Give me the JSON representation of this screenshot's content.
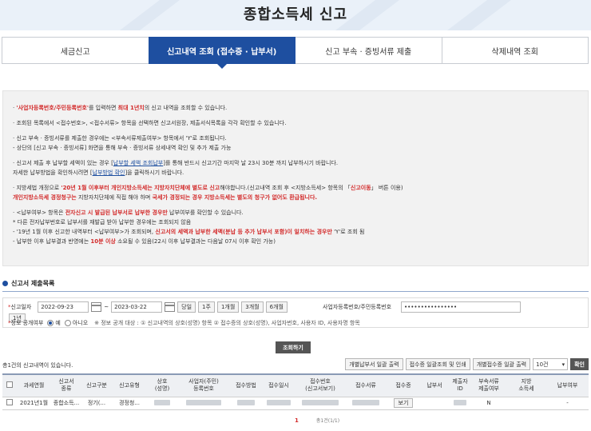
{
  "page_title": "종합소득세 신고",
  "tabs": [
    {
      "label": "세금신고",
      "active": false
    },
    {
      "label": "신고내역 조회 (접수증 · 납부서)",
      "active": true
    },
    {
      "label": "신고 부속 · 증빙서류 제출",
      "active": false
    },
    {
      "label": "삭제내역 조회",
      "active": false
    }
  ],
  "info": {
    "l1_a": "· ",
    "l1_red": "'사업자등록번호/주민등록번호'",
    "l1_b": "를 입력하면 ",
    "l1_bold": "최대 1년치",
    "l1_c": "의 신고 내역을 조회할 수 있습니다.",
    "l2": "· 조회된 목록에서 <접수번호>, <접수서류> 항목을 선택하면 신고서원장, 제출서식목록을 각각 확인할 수 있습니다.",
    "l3": "· 신고 부속 · 증빙서류를 제출한 경우에는 <부속서류제출여부> 항목에서 'Y'로 조회됩니다.",
    "l4": "  - 상단의 [신고 부속 · 증빙서류] 화면을 통해 부속 · 증빙서류 상세내역 확인 및 추가 제출 가능",
    "l5_a": "· 신고서 제출 후 납부할 세액이 있는 경우 [",
    "l5_link": "납부할 세액 조회납부",
    "l5_b": "]를 통해 반드시 신고기간 마지막 날 23시 30분 까지 납부하시기 바랍니다.",
    "l6_a": "  자세한 납부방법을 확인하시려면 [",
    "l6_link": "납부방법 확인",
    "l6_b": "]을 클릭하시기 바랍니다.",
    "l7_a": "· 지방세법 개정으로 ",
    "l7_red": "'20년 1월 이후부터 개인지방소득세는 지방자치단체에 별도로 신고",
    "l7_b": "해야합니다.(신고내역 조회 후 <지방소득세> 항목의 「",
    "l7_red2": "신고이동",
    "l7_c": "」 버튼 이용)",
    "l8_red": "  개인지방소득세 경정청구는",
    "l8_a": " 지방자치단체에 직접 해야 하며 ",
    "l8_red2": "국세가 경정되는 경우 지방소득세는 별도의 청구가 없어도 환급됩니다.",
    "l9_a": "· <납부여부> 항목은 ",
    "l9_red": "전자신고 시 발급된 납부서로 납부한 경우만",
    "l9_b": " 납부여부를 확인할 수 있습니다.",
    "l10": "  * 다른 전자납부번호로 납부서를 재발급 받아 납부한 경우에는 조회되지 않음",
    "l11_a": "  - '19년 1월 이후 신고한 내역부터 <납부여부>가 조회되며, ",
    "l11_red": "신고서의 세액과 납부한 세액(분납 등 추가 납부서 포함)이 일치하는 경우만",
    "l11_b": " 'Y'로 조회 됨",
    "l12_a": "  - 납부한 이후 납부결과 반영에는 ",
    "l12_red": "10분 이상",
    "l12_b": " 소요될 수 있음(22시 이후 납부결과는 다음날 07시 이후 확인 가능)"
  },
  "section_title": "신고서 제출목록",
  "search": {
    "period_label": "신고일자",
    "date_from": "2022-09-23",
    "tilde": "~",
    "date_to": "2023-03-22",
    "quick": [
      "당일",
      "1주",
      "1개월",
      "3개월",
      "6개월"
    ],
    "quick_extra": "1년",
    "id_label": "사업자등록번호/주민등록번호",
    "id_value": "••••••••••••••••",
    "disclosure_label": "정보 공개여부",
    "yes": "예",
    "no": "아니오",
    "note": "※ 정보 공개 대상 : ① 신고내역의 상호(성명) 항목 ② 접수증의 상호(성명), 사업자번호, 사용자 ID, 사용자명 항목",
    "lookup": "조회하기"
  },
  "result_count": "총1건의 신고내역이 있습니다.",
  "actions": {
    "print_tax_bill": "개별납부서 일괄 출력",
    "batch_print": "접수증 일괄조회 및 인쇄",
    "batch_output": "개별접수증 일괄 출력",
    "page_size": "10건",
    "confirm": "확인"
  },
  "table": {
    "headers": [
      "",
      "과세연월",
      "신고서\n종류",
      "신고구분",
      "신고유형",
      "상호\n(성명)",
      "사업자(주민)\n등록번호",
      "접수방법",
      "접수일시",
      "접수번호\n(신고서보기)",
      "접수서류",
      "접수증",
      "납부서",
      "제출자\nID",
      "부속서류\n제출여부",
      "지방\n소득세",
      "납부여부"
    ],
    "rows": [
      {
        "period": "2021년1월",
        "kind": "종합소득...",
        "division": "정기(...",
        "type": "경정청...",
        "receipt": "보기",
        "attach": "N",
        "paid": "-"
      }
    ]
  },
  "pager": {
    "current": "1",
    "total": "총1건(1/1)"
  }
}
